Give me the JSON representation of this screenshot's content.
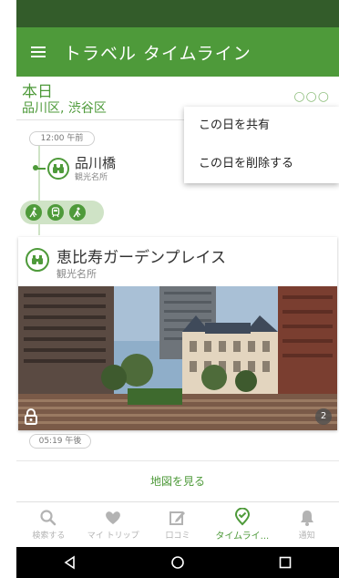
{
  "app": {
    "title": "トラベル タイムライン"
  },
  "day": {
    "title": "本日",
    "area": "品川区, 渋谷区",
    "more": "○○○"
  },
  "menu": {
    "items": [
      {
        "label": "この日を共有"
      },
      {
        "label": "この日を削除する"
      }
    ]
  },
  "timeline": {
    "start_time": "12:00 午前",
    "end_time": "05:19 午後",
    "first_stop": {
      "name": "品川橋",
      "category": "観光名所"
    },
    "transit_icons": [
      "walk-icon",
      "train-icon",
      "walk-icon"
    ],
    "card": {
      "title": "恵比寿ガーデンプレイス",
      "category": "観光名所",
      "photo_count": "2"
    }
  },
  "map_link": "地図を見る",
  "bottom_nav": [
    {
      "label": "検索する",
      "icon": "search-icon",
      "active": false
    },
    {
      "label": "マイ トリップ",
      "icon": "heart-icon",
      "active": false
    },
    {
      "label": "口コミ",
      "icon": "review-icon",
      "active": false
    },
    {
      "label": "タイムライ...",
      "icon": "timeline-pin-icon",
      "active": true
    },
    {
      "label": "通知",
      "icon": "bell-icon",
      "active": false
    }
  ],
  "colors": {
    "brand": "#4e9a3a",
    "status_bar": "#335c2a",
    "inactive": "#b3b3b3"
  }
}
